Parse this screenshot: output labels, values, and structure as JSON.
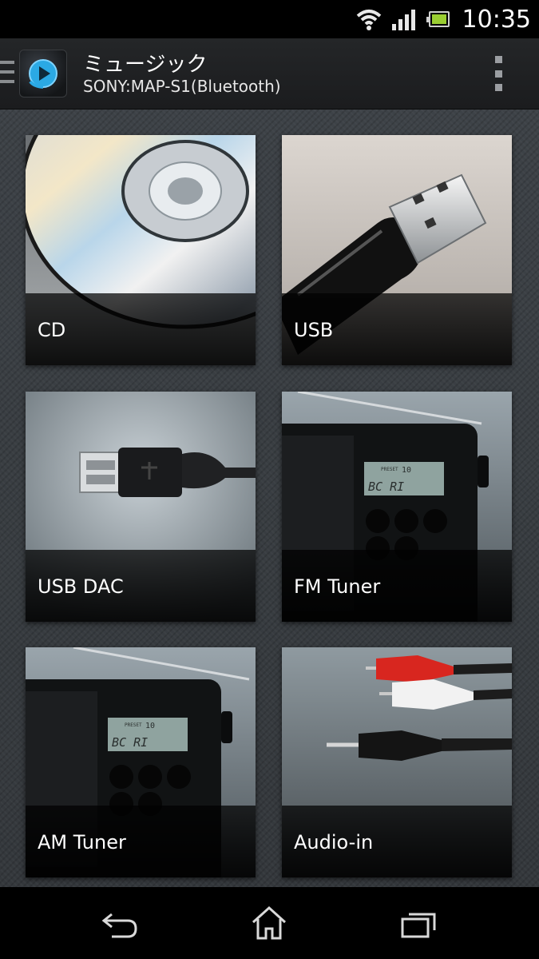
{
  "status_bar": {
    "time": "10:35",
    "icons": [
      "wifi-icon",
      "signal-icon",
      "battery-icon"
    ],
    "battery_color": "#9acd32"
  },
  "action_bar": {
    "title": "ミュージック",
    "subtitle": "SONY:MAP-S1(Bluetooth)",
    "app_icon": "music-play-icon",
    "overflow_icon": "overflow-menu-icon"
  },
  "sources": [
    {
      "label": "CD",
      "icon": "cd-disc-image"
    },
    {
      "label": "USB",
      "icon": "usb-drive-image"
    },
    {
      "label": "USB DAC",
      "icon": "usb-cable-image"
    },
    {
      "label": "FM Tuner",
      "icon": "radio-image"
    },
    {
      "label": "AM Tuner",
      "icon": "radio-image"
    },
    {
      "label": "Audio-in",
      "icon": "audio-cables-image"
    }
  ],
  "radio_display": {
    "preset_label": "PRESET",
    "preset_number": "10",
    "station_text": "BC  RI"
  },
  "nav_bar": {
    "buttons": [
      "back-icon",
      "home-icon",
      "recent-apps-icon"
    ]
  }
}
